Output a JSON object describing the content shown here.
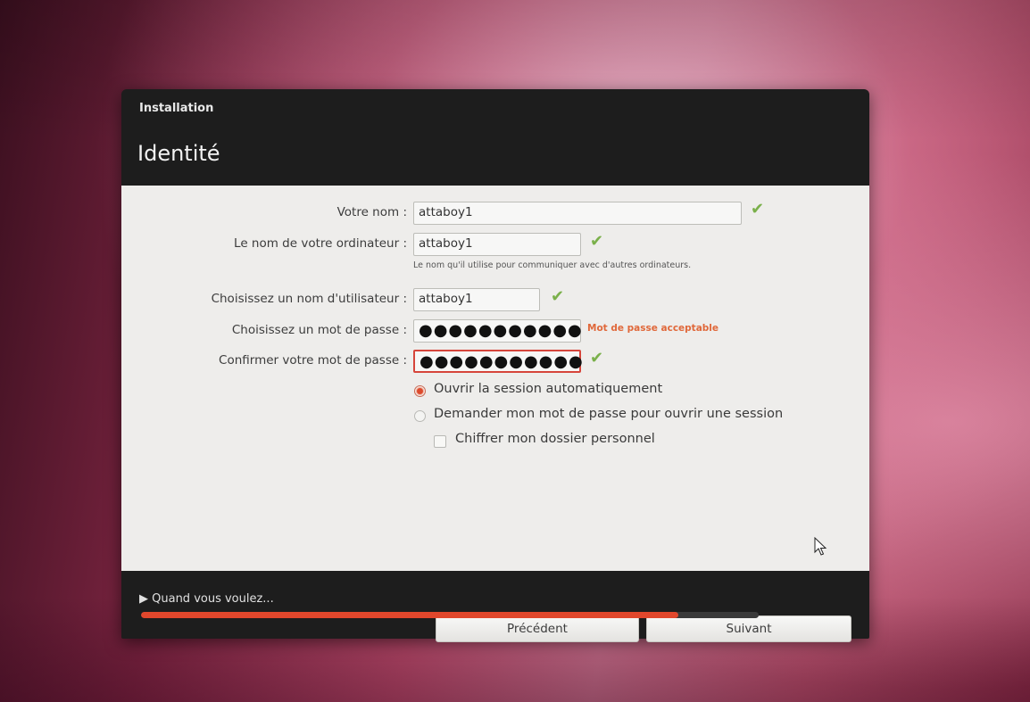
{
  "window": {
    "title": "Installation",
    "page_title": "Identité"
  },
  "form": {
    "name": {
      "label": "Votre nom :",
      "value": "attaboy1"
    },
    "computer": {
      "label": "Le nom de votre ordinateur :",
      "value": "attaboy1",
      "hint": "Le nom qu'il utilise pour communiquer avec d'autres ordinateurs."
    },
    "username": {
      "label": "Choisissez un nom d'utilisateur :",
      "value": "attaboy1"
    },
    "password": {
      "label": "Choisissez un mot de passe :",
      "value": "●●●●●●●●●●●",
      "strength": "Mot de passe acceptable"
    },
    "confirm": {
      "label": "Confirmer votre mot de passe :",
      "value": "●●●●●●●●●●●"
    },
    "login_options": [
      {
        "label": "Ouvrir la session automatiquement",
        "selected": true
      },
      {
        "label": "Demander mon mot de passe pour ouvrir une session",
        "selected": false
      }
    ],
    "encrypt": {
      "label": "Chiffrer mon dossier personnel",
      "checked": false
    }
  },
  "buttons": {
    "back": "Précédent",
    "next": "Suivant"
  },
  "footer": {
    "toggle_label": "▶ Quand vous voulez...",
    "progress": 0.87
  },
  "colors": {
    "accent": "#e1472c",
    "valid_check": "#7ab04a",
    "warning": "#e0683a"
  }
}
